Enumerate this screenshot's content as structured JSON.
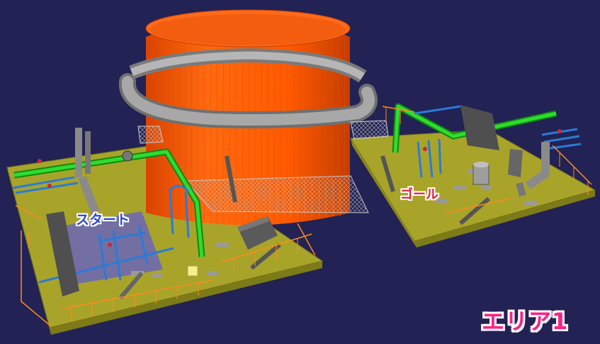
{
  "labels": {
    "start": "スタート",
    "goal": "ゴール",
    "area": "エリア1"
  },
  "colors": {
    "background": "#222255",
    "floor": "#a8a42a",
    "floor_edge": "#7d7a18",
    "railing": "#ff8a1a",
    "tank": "#ff5500",
    "ring_pipe": "#9a9a9a",
    "green_pipe": "#22cc22",
    "blue_pipe": "#2b7bd6",
    "grey_block": "#5a5a5a",
    "start_text": "#2a49d8",
    "goal_text": "#e0203c",
    "area_text": "#ff1f86"
  }
}
